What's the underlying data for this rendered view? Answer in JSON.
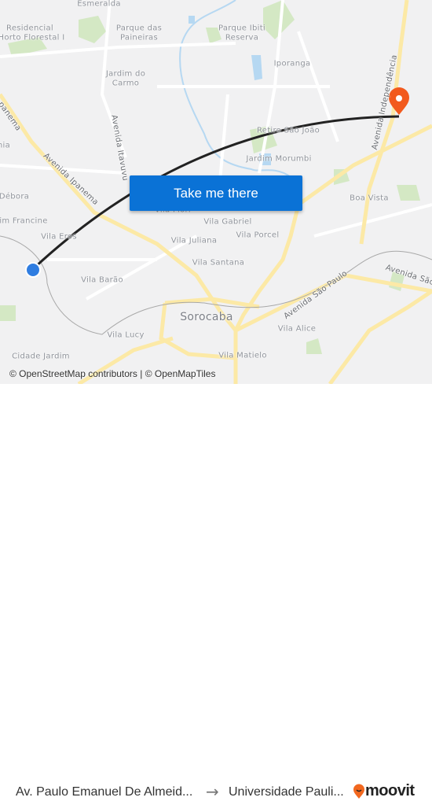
{
  "map": {
    "labels": [
      "Esmeralda",
      "Residencial",
      "Horto Florestal I",
      "Parque das",
      "Paineiras",
      "Parque Ibiti",
      "Reserva",
      "Iporanga",
      "Jardim do",
      "Carmo",
      "Retiro São João",
      "Jardim Morumbi",
      "Boa Vista",
      "Vila Flori",
      "Vila Gabriel",
      "Vila Porcel",
      "Vila Juliana",
      "Vila Santana",
      "Vila Barão",
      "Vila Eros",
      "im Francine",
      "Débora",
      "Sorocaba",
      "Vila Alice",
      "Vila Lucy",
      "Vila Matielo",
      "Cidade Jardim",
      "nia"
    ],
    "roads": [
      "Avenida Ipanema",
      "Avenida Itavuvu",
      "Avenida Independência",
      "Avenida São Paulo",
      "Avenida São",
      "panema"
    ],
    "attribution": "© OpenStreetMap contributors | © OpenMapTiles",
    "colors": {
      "route": "#222222",
      "origin": "#2f7de1",
      "destination": "#f25a1d",
      "button": "#0a72d6",
      "major_road": "#fce9a6",
      "park": "#d4e8c4",
      "water": "#b6d8f2"
    }
  },
  "cta": {
    "label": "Take me there"
  },
  "footer": {
    "origin": "Av. Paulo Emanuel De Almeid...",
    "arrow_icon": "arrow-right-icon",
    "destination": "Universidade Pauli...",
    "brand": "moovit"
  }
}
